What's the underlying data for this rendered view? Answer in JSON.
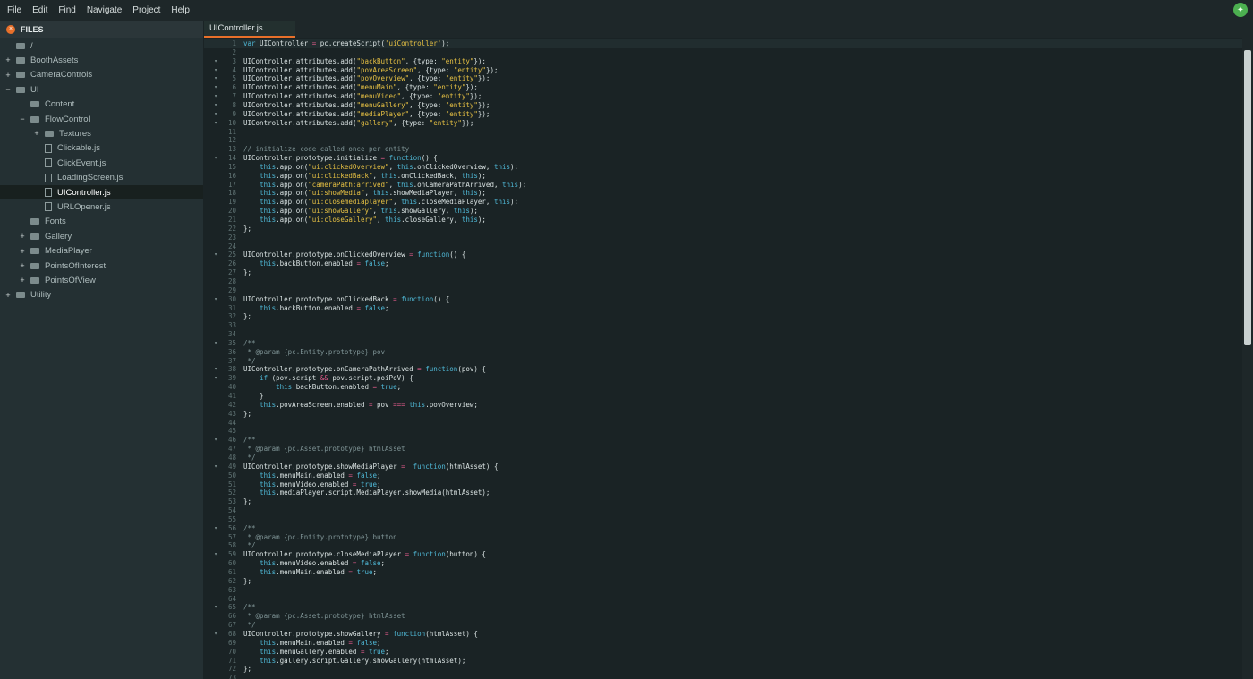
{
  "menubar": {
    "items": [
      "File",
      "Edit",
      "Find",
      "Navigate",
      "Project",
      "Help"
    ]
  },
  "sidebar": {
    "title": "FILES",
    "tree": [
      {
        "label": "/",
        "type": "folder",
        "depth": 0,
        "expander": ""
      },
      {
        "label": "BoothAssets",
        "type": "folder",
        "depth": 0,
        "expander": "+"
      },
      {
        "label": "CameraControls",
        "type": "folder",
        "depth": 0,
        "expander": "+"
      },
      {
        "label": "UI",
        "type": "folder",
        "depth": 0,
        "expander": "−"
      },
      {
        "label": "Content",
        "type": "folder",
        "depth": 1,
        "expander": ""
      },
      {
        "label": "FlowControl",
        "type": "folder",
        "depth": 1,
        "expander": "−"
      },
      {
        "label": "Textures",
        "type": "folder",
        "depth": 2,
        "expander": "+"
      },
      {
        "label": "Clickable.js",
        "type": "file",
        "depth": 2,
        "expander": ""
      },
      {
        "label": "ClickEvent.js",
        "type": "file",
        "depth": 2,
        "expander": ""
      },
      {
        "label": "LoadingScreen.js",
        "type": "file",
        "depth": 2,
        "expander": ""
      },
      {
        "label": "UIController.js",
        "type": "file",
        "depth": 2,
        "expander": "",
        "selected": true
      },
      {
        "label": "URLOpener.js",
        "type": "file",
        "depth": 2,
        "expander": ""
      },
      {
        "label": "Fonts",
        "type": "folder",
        "depth": 1,
        "expander": ""
      },
      {
        "label": "Gallery",
        "type": "folder",
        "depth": 1,
        "expander": "+"
      },
      {
        "label": "MediaPlayer",
        "type": "folder",
        "depth": 1,
        "expander": "+"
      },
      {
        "label": "PointsOfInterest",
        "type": "folder",
        "depth": 1,
        "expander": "+"
      },
      {
        "label": "PointsOfView",
        "type": "folder",
        "depth": 1,
        "expander": "+"
      },
      {
        "label": "Utility",
        "type": "folder",
        "depth": 0,
        "expander": "+"
      }
    ]
  },
  "editor": {
    "tab_label": "UIController.js",
    "lines": [
      {
        "n": "1",
        "fold": "",
        "text": "var UIController = pc.createScript('uiController');"
      },
      {
        "n": "2",
        "fold": "",
        "text": ""
      },
      {
        "n": "3",
        "fold": "▾",
        "text": "UIController.attributes.add(\"backButton\", {type: \"entity\"});"
      },
      {
        "n": "4",
        "fold": "▾",
        "text": "UIController.attributes.add(\"povAreaScreen\", {type: \"entity\"});"
      },
      {
        "n": "5",
        "fold": "▾",
        "text": "UIController.attributes.add(\"povOverview\", {type: \"entity\"});"
      },
      {
        "n": "6",
        "fold": "▾",
        "text": "UIController.attributes.add(\"menuMain\", {type: \"entity\"});"
      },
      {
        "n": "7",
        "fold": "▾",
        "text": "UIController.attributes.add(\"menuVideo\", {type: \"entity\"});"
      },
      {
        "n": "8",
        "fold": "▾",
        "text": "UIController.attributes.add(\"menuGallery\", {type: \"entity\"});"
      },
      {
        "n": "9",
        "fold": "▾",
        "text": "UIController.attributes.add(\"mediaPlayer\", {type: \"entity\"});"
      },
      {
        "n": "10",
        "fold": "▾",
        "text": "UIController.attributes.add(\"gallery\", {type: \"entity\"});"
      },
      {
        "n": "11",
        "fold": "",
        "text": ""
      },
      {
        "n": "12",
        "fold": "",
        "text": ""
      },
      {
        "n": "13",
        "fold": "",
        "text": "// initialize code called once per entity"
      },
      {
        "n": "14",
        "fold": "▾",
        "text": "UIController.prototype.initialize = function() {"
      },
      {
        "n": "15",
        "fold": "",
        "text": "    this.app.on(\"ui:clickedOverview\", this.onClickedOverview, this);"
      },
      {
        "n": "16",
        "fold": "",
        "text": "    this.app.on(\"ui:clickedBack\", this.onClickedBack, this);"
      },
      {
        "n": "17",
        "fold": "",
        "text": "    this.app.on(\"cameraPath:arrived\", this.onCameraPathArrived, this);"
      },
      {
        "n": "18",
        "fold": "",
        "text": "    this.app.on(\"ui:showMedia\", this.showMediaPlayer, this);"
      },
      {
        "n": "19",
        "fold": "",
        "text": "    this.app.on(\"ui:closemediaplayer\", this.closeMediaPlayer, this);"
      },
      {
        "n": "20",
        "fold": "",
        "text": "    this.app.on(\"ui:showGallery\", this.showGallery, this);"
      },
      {
        "n": "21",
        "fold": "",
        "text": "    this.app.on(\"ui:closeGallery\", this.closeGallery, this);"
      },
      {
        "n": "22",
        "fold": "",
        "text": "};"
      },
      {
        "n": "23",
        "fold": "",
        "text": ""
      },
      {
        "n": "24",
        "fold": "",
        "text": ""
      },
      {
        "n": "25",
        "fold": "▾",
        "text": "UIController.prototype.onClickedOverview = function() {"
      },
      {
        "n": "26",
        "fold": "",
        "text": "    this.backButton.enabled = false;"
      },
      {
        "n": "27",
        "fold": "",
        "text": "};"
      },
      {
        "n": "28",
        "fold": "",
        "text": ""
      },
      {
        "n": "29",
        "fold": "",
        "text": ""
      },
      {
        "n": "30",
        "fold": "▾",
        "text": "UIController.prototype.onClickedBack = function() {"
      },
      {
        "n": "31",
        "fold": "",
        "text": "    this.backButton.enabled = false;"
      },
      {
        "n": "32",
        "fold": "",
        "text": "};"
      },
      {
        "n": "33",
        "fold": "",
        "text": ""
      },
      {
        "n": "34",
        "fold": "",
        "text": ""
      },
      {
        "n": "35",
        "fold": "▾",
        "text": "/**"
      },
      {
        "n": "36",
        "fold": "",
        "text": " * @param {pc.Entity.prototype} pov"
      },
      {
        "n": "37",
        "fold": "",
        "text": " */"
      },
      {
        "n": "38",
        "fold": "▾",
        "text": "UIController.prototype.onCameraPathArrived = function(pov) {"
      },
      {
        "n": "39",
        "fold": "▾",
        "text": "    if (pov.script && pov.script.poiPoV) {"
      },
      {
        "n": "40",
        "fold": "",
        "text": "        this.backButton.enabled = true;"
      },
      {
        "n": "41",
        "fold": "",
        "text": "    }"
      },
      {
        "n": "42",
        "fold": "",
        "text": "    this.povAreaScreen.enabled = pov === this.povOverview;"
      },
      {
        "n": "43",
        "fold": "",
        "text": "};"
      },
      {
        "n": "44",
        "fold": "",
        "text": ""
      },
      {
        "n": "45",
        "fold": "",
        "text": ""
      },
      {
        "n": "46",
        "fold": "▾",
        "text": "/**"
      },
      {
        "n": "47",
        "fold": "",
        "text": " * @param {pc.Asset.prototype} htmlAsset"
      },
      {
        "n": "48",
        "fold": "",
        "text": " */"
      },
      {
        "n": "49",
        "fold": "▾",
        "text": "UIController.prototype.showMediaPlayer =  function(htmlAsset) {"
      },
      {
        "n": "50",
        "fold": "",
        "text": "    this.menuMain.enabled = false;"
      },
      {
        "n": "51",
        "fold": "",
        "text": "    this.menuVideo.enabled = true;"
      },
      {
        "n": "52",
        "fold": "",
        "text": "    this.mediaPlayer.script.MediaPlayer.showMedia(htmlAsset);"
      },
      {
        "n": "53",
        "fold": "",
        "text": "};"
      },
      {
        "n": "54",
        "fold": "",
        "text": ""
      },
      {
        "n": "55",
        "fold": "",
        "text": ""
      },
      {
        "n": "56",
        "fold": "▾",
        "text": "/**"
      },
      {
        "n": "57",
        "fold": "",
        "text": " * @param {pc.Entity.prototype} button"
      },
      {
        "n": "58",
        "fold": "",
        "text": " */"
      },
      {
        "n": "59",
        "fold": "▾",
        "text": "UIController.prototype.closeMediaPlayer = function(button) {"
      },
      {
        "n": "60",
        "fold": "",
        "text": "    this.menuVideo.enabled = false;"
      },
      {
        "n": "61",
        "fold": "",
        "text": "    this.menuMain.enabled = true;"
      },
      {
        "n": "62",
        "fold": "",
        "text": "};"
      },
      {
        "n": "63",
        "fold": "",
        "text": ""
      },
      {
        "n": "64",
        "fold": "",
        "text": ""
      },
      {
        "n": "65",
        "fold": "▾",
        "text": "/**"
      },
      {
        "n": "66",
        "fold": "",
        "text": " * @param {pc.Asset.prototype} htmlAsset"
      },
      {
        "n": "67",
        "fold": "",
        "text": " */"
      },
      {
        "n": "68",
        "fold": "▾",
        "text": "UIController.prototype.showGallery = function(htmlAsset) {"
      },
      {
        "n": "69",
        "fold": "",
        "text": "    this.menuMain.enabled = false;"
      },
      {
        "n": "70",
        "fold": "",
        "text": "    this.menuGallery.enabled = true;"
      },
      {
        "n": "71",
        "fold": "",
        "text": "    this.gallery.script.Gallery.showGallery(htmlAsset);"
      },
      {
        "n": "72",
        "fold": "",
        "text": "};"
      },
      {
        "n": "73",
        "fold": "",
        "text": ""
      }
    ]
  },
  "colors": {
    "keyword": "#4fb8d6",
    "string": "#e6c043",
    "comment": "#7f9496",
    "operator": "#e05a8a",
    "function": "#58c9a0",
    "accent": "#e8702a"
  }
}
